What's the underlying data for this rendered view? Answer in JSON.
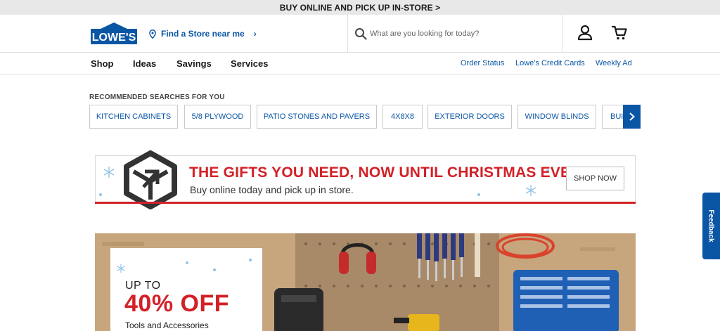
{
  "promo": {
    "text": "BUY ONLINE AND PICK UP IN-STORE >"
  },
  "header": {
    "logo_text": "LOWE'S",
    "store_link": "Find a Store near me",
    "search_placeholder": "What are you looking for today?",
    "icons": [
      "map-pin-icon",
      "search-icon",
      "account-icon",
      "cart-icon"
    ]
  },
  "nav": {
    "primary": [
      "Shop",
      "Ideas",
      "Savings",
      "Services"
    ],
    "secondary": [
      "Order Status",
      "Lowe's Credit Cards",
      "Weekly Ad"
    ]
  },
  "recommended": {
    "title": "RECOMMENDED SEARCHES FOR YOU",
    "chips": [
      "KITCHEN CABINETS",
      "5/8 PLYWOOD",
      "PATIO STONES AND PAVERS",
      "4X8X8",
      "EXTERIOR DOORS",
      "WINDOW BLINDS",
      "BUI"
    ]
  },
  "holiday_banner": {
    "title": "THE GIFTS YOU NEED, NOW UNTIL CHRISTMAS EVE",
    "subtitle": "Buy online today and pick up in store.",
    "cta": "SHOP NOW"
  },
  "tools_hero": {
    "up_to": "UP TO",
    "discount": "40% OFF",
    "category": "Tools and Accessories"
  },
  "feedback": {
    "label": "Feedback"
  },
  "colors": {
    "brand_blue": "#0b56a4",
    "accent_red": "#d32027"
  }
}
